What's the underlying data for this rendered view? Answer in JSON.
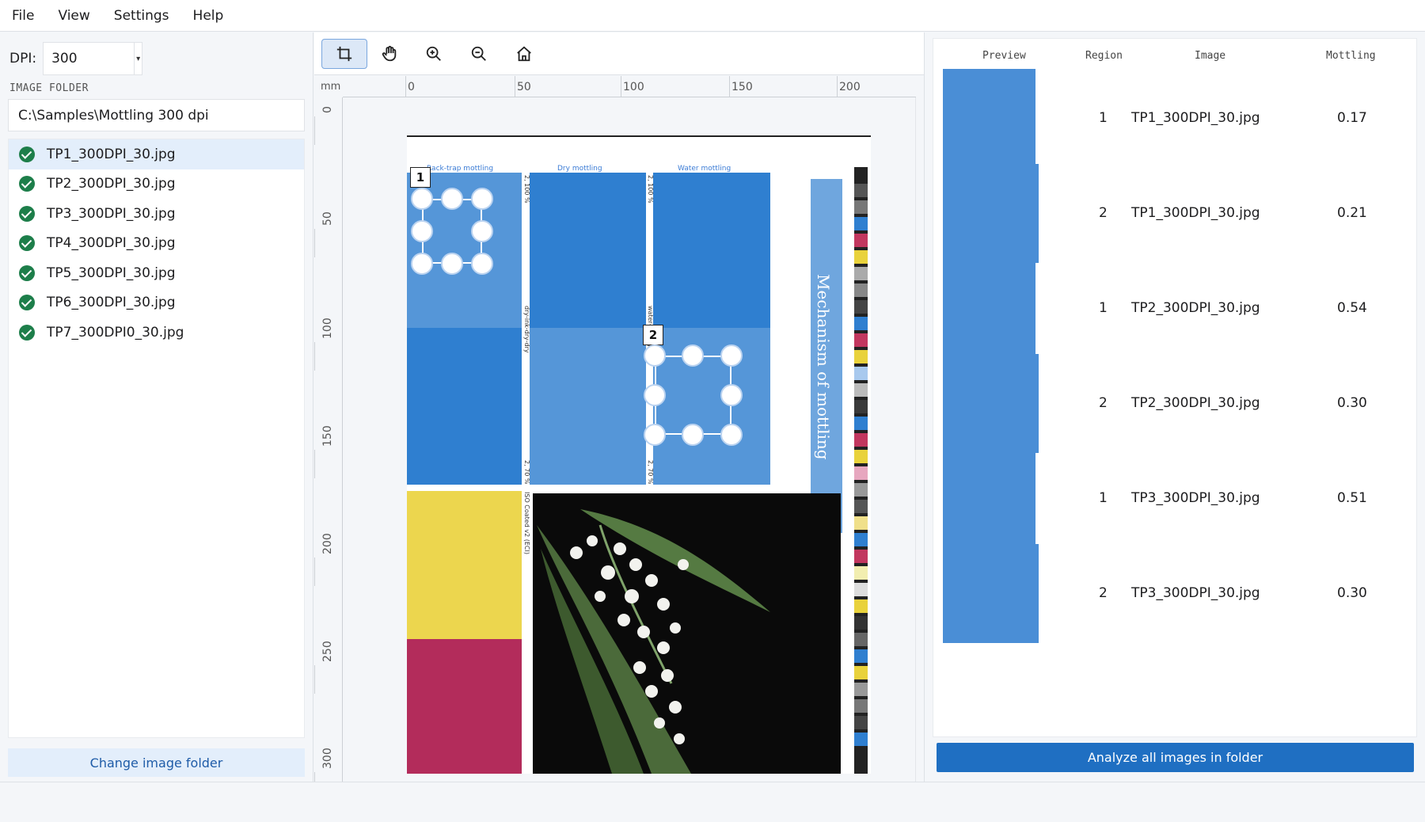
{
  "menu": {
    "file": "File",
    "view": "View",
    "settings": "Settings",
    "help": "Help"
  },
  "left": {
    "dpi_label": "DPI:",
    "dpi_value": "300",
    "folder_label": "IMAGE FOLDER",
    "folder_path": "C:\\Samples\\Mottling 300 dpi",
    "files": [
      "TP1_300DPI_30.jpg",
      "TP2_300DPI_30.jpg",
      "TP3_300DPI_30.jpg",
      "TP4_300DPI_30.jpg",
      "TP5_300DPI_30.jpg",
      "TP6_300DPI_30.jpg",
      "TP7_300DPI0_30.jpg"
    ],
    "selected_index": 0,
    "change_folder": "Change image folder"
  },
  "toolbar": {
    "tools": [
      "crop-icon",
      "hand-icon",
      "zoom-in-icon",
      "zoom-out-icon",
      "home-icon"
    ],
    "active": "crop-icon"
  },
  "viewer": {
    "unit": "mm",
    "h_ticks": [
      "0",
      "50",
      "100",
      "150",
      "200"
    ],
    "v_ticks": [
      "0",
      "50",
      "100",
      "150",
      "200",
      "250",
      "300"
    ],
    "doc": {
      "headers": [
        "Rack-trap mottling",
        "Dry mottling",
        "Water mottling"
      ],
      "title": "Mechanism of mottling",
      "vertical_notes": [
        "2, 100 %",
        "dry-ink-dry-dry",
        "2, 70 %",
        "2, 100 %",
        "water-ink-dry-dry",
        "2, 70 %",
        "ISO Coated v2 (ECI)"
      ],
      "regions": [
        "1",
        "2"
      ],
      "colors": {
        "blue_dark": "#2f7fd0",
        "blue_light": "#5596d8",
        "yellow": "#ecd64e",
        "magenta": "#b32c5b",
        "photo_bg": "#0a0a0a"
      }
    }
  },
  "results": {
    "headers": [
      "Preview",
      "Region",
      "Image",
      "Mottling"
    ],
    "rows": [
      {
        "region": "1",
        "image": "TP1_300DPI_30.jpg",
        "mottling": "0.17"
      },
      {
        "region": "2",
        "image": "TP1_300DPI_30.jpg",
        "mottling": "0.21"
      },
      {
        "region": "1",
        "image": "TP2_300DPI_30.jpg",
        "mottling": "0.54"
      },
      {
        "region": "2",
        "image": "TP2_300DPI_30.jpg",
        "mottling": "0.30"
      },
      {
        "region": "1",
        "image": "TP3_300DPI_30.jpg",
        "mottling": "0.51"
      },
      {
        "region": "2",
        "image": "TP3_300DPI_30.jpg",
        "mottling": "0.30"
      }
    ],
    "analyze": "Analyze all images in folder"
  }
}
